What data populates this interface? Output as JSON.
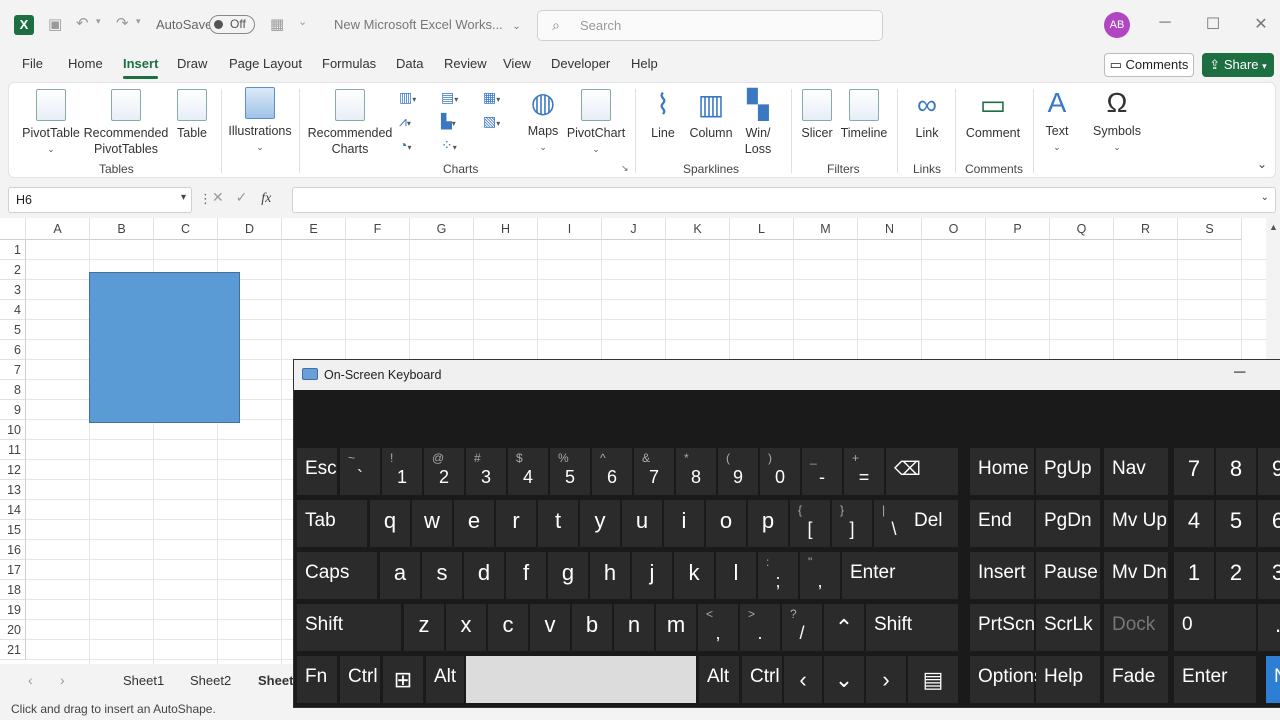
{
  "titlebar": {
    "autosave_label": "AutoSave",
    "autosave_state": "Off",
    "document_name": "New Microsoft Excel Works...",
    "search_placeholder": "Search",
    "user_initials": "AB"
  },
  "menu": {
    "tabs": [
      "File",
      "Home",
      "Insert",
      "Draw",
      "Page Layout",
      "Formulas",
      "Data",
      "Review",
      "View",
      "Developer",
      "Help"
    ],
    "active_tab": "Insert",
    "comments_label": "Comments",
    "share_label": "Share"
  },
  "ribbon": {
    "buttons": {
      "pivottable": "PivotTable",
      "recommended_pivot": "Recommended PivotTables",
      "table": "Table",
      "illustrations": "Illustrations",
      "recommended_charts": "Recommended Charts",
      "maps": "Maps",
      "pivotchart": "PivotChart",
      "line": "Line",
      "column": "Column",
      "winloss": "Win/ Loss",
      "slicer": "Slicer",
      "timeline": "Timeline",
      "link": "Link",
      "comment": "Comment",
      "text": "Text",
      "symbols": "Symbols"
    },
    "groups": {
      "tables": "Tables",
      "charts": "Charts",
      "sparklines": "Sparklines",
      "filters": "Filters",
      "links": "Links",
      "comments": "Comments"
    }
  },
  "formula_bar": {
    "name_box": "H6",
    "formula": ""
  },
  "grid": {
    "columns": [
      "A",
      "B",
      "C",
      "D",
      "E",
      "F",
      "G",
      "H",
      "I",
      "J",
      "K",
      "L",
      "M",
      "N",
      "O",
      "P",
      "Q",
      "R",
      "S"
    ],
    "rows": [
      "1",
      "2",
      "3",
      "4",
      "5",
      "6",
      "7",
      "8",
      "9",
      "10",
      "11",
      "12",
      "13",
      "14",
      "15",
      "16",
      "17",
      "18",
      "19",
      "20",
      "21"
    ],
    "shape_color": "#5b9bd5"
  },
  "sheets": {
    "tabs": [
      "Sheet1",
      "Sheet2",
      "Sheet"
    ],
    "active": "Sheet"
  },
  "status": {
    "message": "Click and drag to insert an AutoShape."
  },
  "osk": {
    "title": "On-Screen Keyboard",
    "row1": [
      {
        "s": "~",
        "m": "`"
      },
      {
        "s": "!",
        "m": "1"
      },
      {
        "s": "@",
        "m": "2"
      },
      {
        "s": "#",
        "m": "3"
      },
      {
        "s": "$",
        "m": "4"
      },
      {
        "s": "%",
        "m": "5"
      },
      {
        "s": "^",
        "m": "6"
      },
      {
        "s": "&",
        "m": "7"
      },
      {
        "s": "*",
        "m": "8"
      },
      {
        "s": "(",
        "m": "9"
      },
      {
        "s": ")",
        "m": "0"
      },
      {
        "s": "_",
        "m": "-"
      },
      {
        "s": "+",
        "m": "="
      }
    ],
    "row2": [
      "q",
      "w",
      "e",
      "r",
      "t",
      "y",
      "u",
      "i",
      "o",
      "p"
    ],
    "row2_sym": [
      {
        "s": "{",
        "m": "["
      },
      {
        "s": "}",
        "m": "]"
      },
      {
        "s": "|",
        "m": "\\"
      }
    ],
    "row3": [
      "a",
      "s",
      "d",
      "f",
      "g",
      "h",
      "j",
      "k",
      "l"
    ],
    "row3_sym": [
      {
        "s": ":",
        "m": ";"
      },
      {
        "s": "\"",
        "m": ","
      }
    ],
    "row4": [
      "z",
      "x",
      "c",
      "v",
      "b",
      "n",
      "m"
    ],
    "row4_sym": [
      {
        "s": "<",
        "m": ","
      },
      {
        "s": ">",
        "m": "."
      },
      {
        "s": "?",
        "m": "/"
      }
    ],
    "keys": {
      "esc": "Esc",
      "tab": "Tab",
      "caps": "Caps",
      "shift": "Shift",
      "fn": "Fn",
      "ctrl": "Ctrl",
      "alt": "Alt",
      "del": "Del",
      "enter": "Enter",
      "home": "Home",
      "pgup": "PgUp",
      "nav": "Nav",
      "end": "End",
      "pgdn": "PgDn",
      "mvup": "Mv Up",
      "insert": "Insert",
      "pause": "Pause",
      "mvdn": "Mv Dn",
      "prtscn": "PrtScn",
      "scrlk": "ScrLk",
      "dock": "Dock",
      "options": "Options",
      "help": "Help",
      "fade": "Fade",
      "n_partial": "N"
    },
    "numpad": [
      "7",
      "8",
      "9",
      "4",
      "5",
      "6",
      "1",
      "2",
      "3",
      "0",
      "."
    ]
  }
}
